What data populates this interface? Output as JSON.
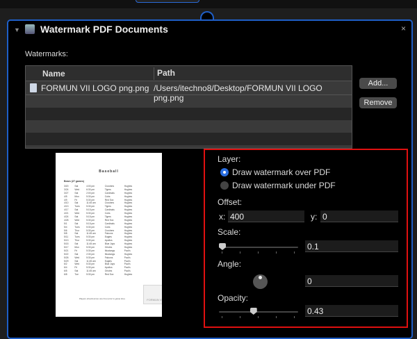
{
  "window": {
    "title": "Watermark PDF Documents",
    "close": "×"
  },
  "watermarks": {
    "label": "Watermarks:",
    "columns": [
      "Name",
      "Path"
    ],
    "rows": [
      {
        "name": "FORMUN VII LOGO png.png",
        "path": "/Users/itechno8/Desktop/FORMUN VII LOGO png.png"
      }
    ],
    "add": "Add...",
    "remove": "Remove"
  },
  "preview": {
    "title": "Baseball",
    "subtitle": "Bears (27 games)",
    "footer": "Players should arrive one hour prior to game time.",
    "watermark": "FORMUN VII",
    "rows": [
      [
        "3/20",
        "Sat",
        "4:00 pm",
        "Crushers",
        "Hughes"
      ],
      [
        "3/24",
        "Wed",
        "6:30 pm",
        "Tigers",
        "Hughes"
      ],
      [
        "3/27",
        "Sat",
        "2:00 pm",
        "Cardinals",
        "Hughes"
      ],
      [
        "4/5",
        "Mon",
        "5:30 pm",
        "Cubs",
        "Hughes"
      ],
      [
        "4/9",
        "Fri",
        "5:30 pm",
        "Red Sox",
        "Hughes"
      ],
      [
        "4/10",
        "Sat",
        "11:45 am",
        "Crushers",
        "Hughes"
      ],
      [
        "4/13",
        "Tues",
        "5:30 pm",
        "Tigers",
        "Hughes"
      ],
      [
        "4/17",
        "Sat",
        "5:15 pm",
        "Cardinals",
        "Hughes"
      ],
      [
        "4/21",
        "Wed",
        "5:30 pm",
        "Cubs",
        "Hughes"
      ],
      [
        "4/24",
        "Sat",
        "5:15 pm",
        "Tigers",
        "Hughes"
      ],
      [
        "4/28",
        "Wed",
        "5:30 pm",
        "Red Sox",
        "Hughes"
      ],
      [
        "5/1",
        "Sat",
        "5:15 pm",
        "Cardinals",
        "Hughes"
      ],
      [
        "5/4",
        "Tues",
        "5:30 pm",
        "Cubs",
        "Hughes"
      ],
      [
        "5/6",
        "Thur",
        "5:30 pm",
        "Crushers",
        "Hughes"
      ],
      [
        "5/8",
        "Sat",
        "11:45 am",
        "Falcons",
        "Hughes"
      ],
      [
        "5/11",
        "Tues",
        "5:30 pm",
        "Eagles",
        "Hughes"
      ],
      [
        "5/13",
        "Thur",
        "5:30 pm",
        "Apollos",
        "Hughes"
      ],
      [
        "5/15",
        "Sat",
        "11:45 am",
        "Blue Jays",
        "Hughes"
      ],
      [
        "5/17",
        "Mon",
        "5:30 pm",
        "Orioles",
        "Hughes"
      ],
      [
        "5/21",
        "Fri",
        "5:30 pm",
        "Mustangs",
        "Paul's"
      ],
      [
        "5/22",
        "Sat",
        "2:30 pm",
        "Mustangs",
        "Hughes"
      ],
      [
        "5/26",
        "Wed",
        "5:30 pm",
        "Falcons",
        "Paul's"
      ],
      [
        "5/29",
        "Sat",
        "11:45 am",
        "Eagles",
        "Paul's"
      ],
      [
        "6/2",
        "Wed",
        "5:30 pm",
        "Blue Jays",
        "Paul's"
      ],
      [
        "6/4",
        "Fri",
        "5:30 pm",
        "Apollos",
        "Paul's"
      ],
      [
        "6/5",
        "Sat",
        "11:45 am",
        "Orioles",
        "Paul's"
      ],
      [
        "6/8",
        "Tue",
        "5:30 pm",
        "Red Sox",
        "Hughes"
      ]
    ]
  },
  "settings": {
    "layer_label": "Layer:",
    "layer_options": [
      "Draw watermark over PDF",
      "Draw watermark under PDF"
    ],
    "layer_selected": 0,
    "offset_label": "Offset:",
    "x_label": "x:",
    "x_value": "400",
    "y_label": "y:",
    "y_value": "0",
    "scale_label": "Scale:",
    "scale_value": "0.1",
    "scale_fraction": 0.0,
    "angle_label": "Angle:",
    "angle_value": "0",
    "opacity_label": "Opacity:",
    "opacity_value": "0.43",
    "opacity_fraction": 0.43
  },
  "colors": {
    "accent": "#1f5fc8",
    "highlight": "#e01010"
  }
}
